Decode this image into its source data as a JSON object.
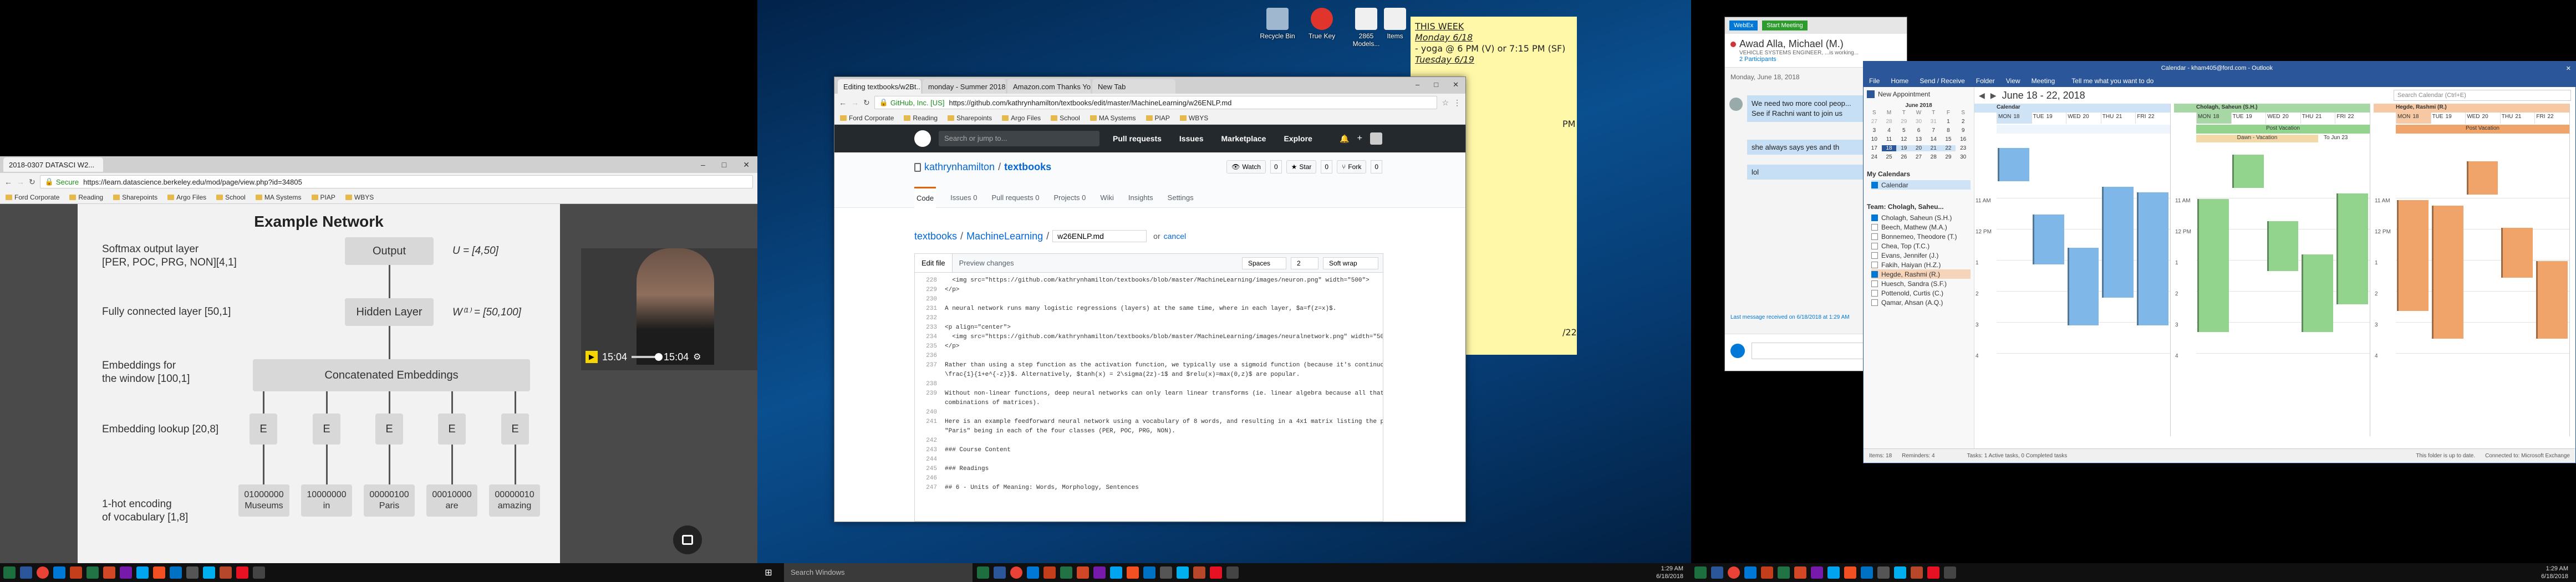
{
  "left_monitor": {
    "browser": {
      "tab_title": "2018-0307 DATASCI W2...",
      "secure_label": "Secure",
      "url": "https://learn.datascience.berkeley.edu/mod/page/view.php?id=34805",
      "bookmarks": [
        "Ford Corporate",
        "Reading",
        "Sharepoints",
        "Argo Files",
        "School",
        "MA Systems",
        "PIAP",
        "WBYS"
      ]
    },
    "slide": {
      "title": "Example Network",
      "softmax_label": "Softmax output layer\n[PER, POC, PRG, NON][4,1]",
      "fc_label": "Fully connected layer [50,1]",
      "concat_label": "Embeddings for\nthe window [100,1]",
      "lookup_label": "Embedding lookup [20,8]",
      "onehot_label": "1-hot encoding\nof vocabulary [1,8]",
      "output_box": "Output",
      "hidden_box": "Hidden Layer",
      "concat_box": "Concatenated Embeddings",
      "u_eq": "U = [4,50]",
      "w_eq": "W⁽¹⁾ = [50,100]",
      "e_box": "E",
      "onehot": [
        {
          "code": "01000000",
          "word": "Museums"
        },
        {
          "code": "10000000",
          "word": "in"
        },
        {
          "code": "00000100",
          "word": "Paris"
        },
        {
          "code": "00010000",
          "word": "are"
        },
        {
          "code": "00000010",
          "word": "amazing"
        }
      ]
    },
    "video": {
      "time_current": "15:04",
      "time_total": "15:04"
    }
  },
  "middle_monitor": {
    "desktop_icons": [
      "Recycle Bin",
      "True Key",
      "2865 Models...",
      "Items"
    ],
    "sticky_note": {
      "heading": "THIS WEEK",
      "lines": [
        "Monday 6/18",
        "- yoga @ 6 PM (V) or 7:15 PM (SF)",
        "Tuesday 6/19"
      ],
      "fragment_1": "PM (F)",
      "fragment_2": "/22"
    },
    "browser": {
      "tabs": [
        "Editing textbooks/w2Bt...",
        "monday - Summer 2018",
        "Amazon.com Thanks You",
        "New Tab"
      ],
      "secure_label": "GitHub, Inc. [US]",
      "url": "https://github.com/kathrynhamilton/textbooks/edit/master/MachineLearning/w26ENLP.md",
      "bookmarks": [
        "Ford Corporate",
        "Reading",
        "Sharepoints",
        "Argo Files",
        "School",
        "MA Systems",
        "PIAP",
        "WBYS"
      ]
    },
    "github": {
      "search_placeholder": "Search or jump to...",
      "nav": [
        "Pull requests",
        "Issues",
        "Marketplace",
        "Explore"
      ],
      "owner": "kathrynhamilton",
      "repo": "textbooks",
      "watch": "Watch",
      "watch_count": "0",
      "star": "Star",
      "star_count": "0",
      "fork": "Fork",
      "fork_count": "0",
      "repo_tabs": [
        "Code",
        "Issues 0",
        "Pull requests 0",
        "Projects 0",
        "Wiki",
        "Insights",
        "Settings"
      ],
      "breadcrumb_repo": "textbooks",
      "breadcrumb_dir": "MachineLearning",
      "filename": "w26ENLP.md",
      "or": "or",
      "cancel": "cancel",
      "edit_tab": "Edit file",
      "preview_tab": "Preview changes",
      "indent_mode": "Spaces",
      "indent_size": "2",
      "wrap_mode": "Soft wrap",
      "code_lines": [
        {
          "n": "228",
          "t": "  <img src=\"https://github.com/kathrynhamilton/textbooks/blob/master/MachineLearning/images/neuron.png\" width=\"500\">"
        },
        {
          "n": "229",
          "t": "</p>"
        },
        {
          "n": "230",
          "t": ""
        },
        {
          "n": "231",
          "t": "A neural network runs many logistic regressions (layers) at the same time, where in each layer, $a=f(z=x)$."
        },
        {
          "n": "232",
          "t": ""
        },
        {
          "n": "233",
          "t": "<p align=\"center\">"
        },
        {
          "n": "234",
          "t": "  <img src=\"https://github.com/kathrynhamilton/textbooks/blob/master/MachineLearning/images/neuralnetwork.png\" width=\"500\">"
        },
        {
          "n": "235",
          "t": "</p>"
        },
        {
          "n": "236",
          "t": ""
        },
        {
          "n": "237",
          "t": "Rather than using a step function as the activation function, we typically use a sigmoid function (because it's continuous), $f(z) ="
        },
        {
          "n": "",
          "t": "\\frac{1}{1+e^{-z}}$. Alternatively, $tanh(x) = 2\\sigma(2z)-1$ and $relu(x)=max(0,z)$ are popular."
        },
        {
          "n": "238",
          "t": ""
        },
        {
          "n": "239",
          "t": "Without non-linear functions, deep neural networks can only learn linear transforms (ie. linear algebra because all that happens is"
        },
        {
          "n": "",
          "t": "combinations of matrices)."
        },
        {
          "n": "240",
          "t": ""
        },
        {
          "n": "241",
          "t": "Here is an example feedforward neural network using a vocabulary of 8 words, and resulting in a 4x1 matrix listing the probabilities of"
        },
        {
          "n": "",
          "t": "\"Paris\" being in each of the four classes (PER, POC, PRG, NON)."
        },
        {
          "n": "242",
          "t": ""
        },
        {
          "n": "243",
          "t": "### Course Content"
        },
        {
          "n": "244",
          "t": ""
        },
        {
          "n": "245",
          "t": "### Readings"
        },
        {
          "n": "246",
          "t": ""
        },
        {
          "n": "247",
          "t": "## 6 - Units of Meaning: Words, Morphology, Sentences"
        }
      ]
    },
    "taskbar_search": "Search Windows",
    "clock_time": "1:29 AM",
    "clock_date": "6/18/2018"
  },
  "right_monitor": {
    "skype": {
      "tabs": [
        "WebEx",
        "Start Meeting"
      ],
      "contact_name": "Awad Alla, Michael (M.)",
      "contact_title": "VEHICLE SYSTEMS ENGINEER, ...is working...",
      "participants": "2 Participants",
      "date": "Monday, June 18, 2018",
      "msg1": "We need two more cool peop...",
      "msg1b": "See if Rachni want to join us",
      "msg2": "she always says yes and th",
      "msg3": "lol",
      "footer": "Last message received on 6/18/2018 at 1:29 AM"
    },
    "outlook": {
      "window_title": "Calendar - kham405@ford.com - Outlook",
      "ribbon_tabs": [
        "File",
        "Home",
        "Send / Receive",
        "Folder",
        "View",
        "Meeting"
      ],
      "ribbon_tell": "Tell me what you want to do",
      "new_appointment": "New Appointment",
      "mini_month": "June 2018",
      "mini_days_header": [
        "S",
        "M",
        "T",
        "W",
        "T",
        "F",
        "S"
      ],
      "mini_days": [
        "27",
        "28",
        "29",
        "30",
        "31",
        "1",
        "2",
        "3",
        "4",
        "5",
        "6",
        "7",
        "8",
        "9",
        "10",
        "11",
        "12",
        "13",
        "14",
        "15",
        "16",
        "17",
        "18",
        "19",
        "20",
        "21",
        "22",
        "23",
        "24",
        "25",
        "26",
        "27",
        "28",
        "29",
        "30"
      ],
      "my_calendars": "My Calendars",
      "calendar_item": "Calendar",
      "team_header": "Team: Cholagh, Saheu...",
      "team": [
        "Cholagh, Saheun (S.H.)",
        "Beech, Mathew (M.A.)",
        "Bonnemeo, Theodore (T.)",
        "Chea, Top (T.C.)",
        "Evans, Jennifer (J.)",
        "Fakih, Haiyan (H.Z.)",
        "Hegde, Rashmi (R.)",
        "Huesch, Sandra (S.F.)",
        "Pottenold, Curtis (C.)",
        "Qamar, Ahsan (A.Q.)"
      ],
      "date_range": "June 18 - 22, 2018",
      "search_placeholder": "Search Calendar (Ctrl+E)",
      "calendars": [
        {
          "name": "Calendar",
          "days": [
            {
              "d": "MON",
              "n": "18"
            },
            {
              "d": "TUE",
              "n": "19"
            },
            {
              "d": "WED",
              "n": "20"
            },
            {
              "d": "THU",
              "n": "21"
            },
            {
              "d": "FRI",
              "n": "22"
            }
          ]
        },
        {
          "name": "Cholagh, Saheun (S.H.)",
          "days": [
            {
              "d": "MON",
              "n": "18"
            },
            {
              "d": "TUE",
              "n": "19"
            },
            {
              "d": "WED",
              "n": "20"
            },
            {
              "d": "THU",
              "n": "21"
            },
            {
              "d": "FRI",
              "n": "22"
            }
          ]
        },
        {
          "name": "Hegde, Rashmi (R.)",
          "days": [
            {
              "d": "MON",
              "n": "18"
            },
            {
              "d": "TUE",
              "n": "19"
            },
            {
              "d": "WED",
              "n": "20"
            },
            {
              "d": "THU",
              "n": "21"
            },
            {
              "d": "FRI",
              "n": "22"
            }
          ]
        }
      ],
      "time_labels": [
        "11 AM",
        "12 PM",
        "1",
        "2",
        "3",
        "4"
      ],
      "status_left": "Items: 18",
      "status_reminders": "Reminders: 4",
      "status_tasks": "Tasks: 1 Active tasks, 0 Completed tasks",
      "status_right": "This folder is up to date.",
      "status_conn": "Connected to: Microsoft Exchange",
      "post_vacation": "Post Vacation",
      "dawn_vacation": "Dawn - Vacation",
      "to_jun": "To Jun 23"
    },
    "clock_time": "1:29 AM",
    "clock_date": "6/18/2018"
  },
  "colors": {
    "accent": "#0078d7",
    "outlook_blue": "#2b579a",
    "github_dark": "#24292e",
    "taskbar": "#101010",
    "sticky": "#fff8a8",
    "slide_bg": "#f2f2f2"
  }
}
